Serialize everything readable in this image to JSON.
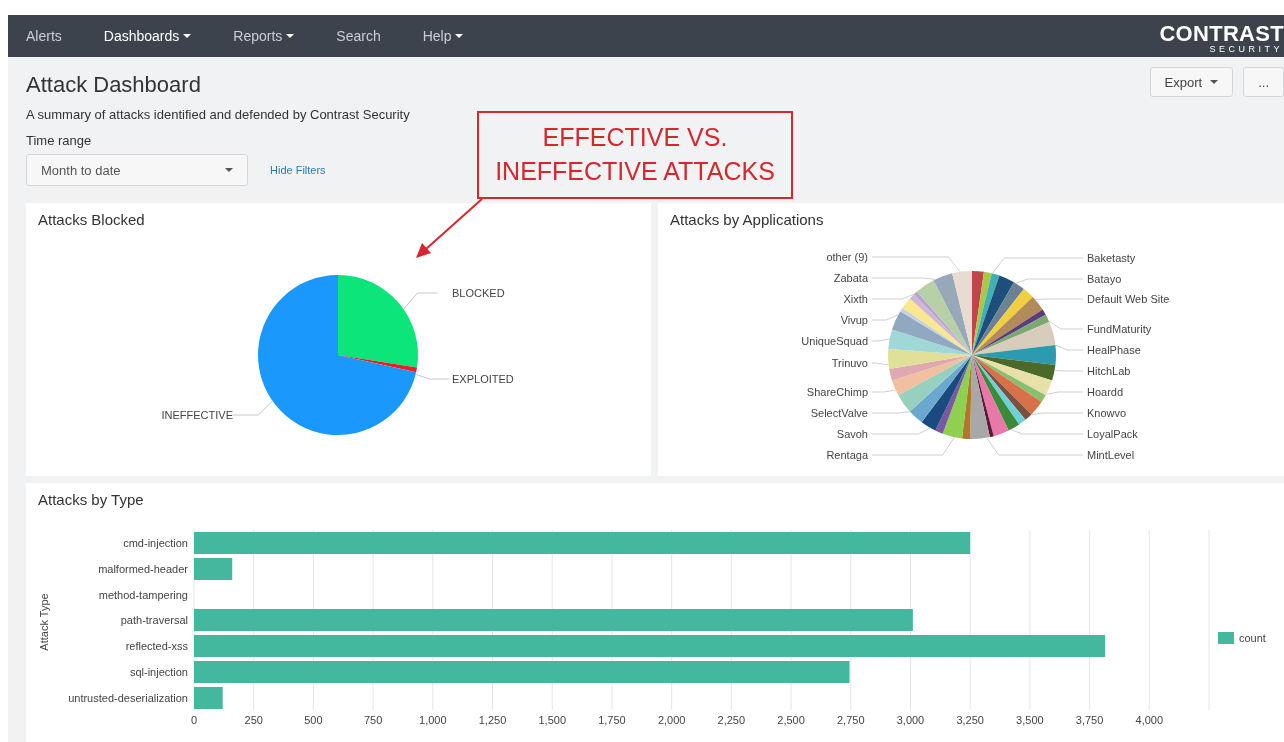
{
  "nav": {
    "items": [
      {
        "label": "Alerts",
        "caret": false,
        "selected": false
      },
      {
        "label": "Dashboards",
        "caret": true,
        "selected": true
      },
      {
        "label": "Reports",
        "caret": true,
        "selected": false
      },
      {
        "label": "Search",
        "caret": false,
        "selected": false
      },
      {
        "label": "Help",
        "caret": true,
        "selected": false
      }
    ],
    "logo": {
      "name": "CONTRAST",
      "tagline": "SECURITY"
    }
  },
  "page": {
    "title": "Attack Dashboard",
    "subtitle": "A summary of attacks identified and defended by Contrast Security",
    "actions": [
      {
        "label": "Export",
        "caret": true
      },
      {
        "label": "...",
        "caret": false
      }
    ],
    "filter": {
      "label": "Time range",
      "value": "Month to date",
      "link": "Hide Filters"
    }
  },
  "annotation": {
    "text": "EFFECTIVE VS. INEFFECTIVE ATTACKS"
  },
  "panels": [
    {
      "kind": "pie",
      "title": "Attacks Blocked",
      "slices": [
        {
          "label": "BLOCKED",
          "color": "#0be57a"
        },
        {
          "label": "EXPLOITED",
          "color": "#ee1d24"
        },
        {
          "label": "INEFFECTIVE",
          "color": "#1a98fc"
        }
      ]
    },
    {
      "kind": "multipie",
      "title": "Attacks by Applications",
      "left_labels": [
        "other (9)",
        "Zabata",
        "Xixth",
        "Vivup",
        "UniqueSquad",
        "Trinuvo",
        "ShareChimp",
        "SelectValve",
        "Savoh",
        "Rentaga"
      ],
      "right_labels": [
        "Baketasty",
        "Batayo",
        "Default Web Site",
        "FundMaturity",
        "HealPhase",
        "HitchLab",
        "Hoardd",
        "Knowvo",
        "LoyalPack",
        "MintLevel"
      ]
    },
    {
      "kind": "bar",
      "title": "Attacks by Type",
      "chart_data": {
        "type": "bar",
        "orientation": "horizontal",
        "ylabel": "Attack Type",
        "categories": [
          "cmd-injection",
          "malformed-header",
          "method-tampering",
          "path-traversal",
          "reflected-xss",
          "sql-injection",
          "untrusted-deserialization"
        ],
        "grid": true,
        "series": [
          {
            "name": "count",
            "color": "#43b89f",
            "values": [
              3250,
              160,
              0,
              3010,
              3815,
              2745,
              120
            ]
          }
        ],
        "xlim": [
          0,
          4250
        ],
        "xticks": [
          {
            "value": 0,
            "label": "0"
          },
          {
            "value": 250,
            "label": "250"
          },
          {
            "value": 500,
            "label": "500"
          },
          {
            "value": 750,
            "label": "750"
          },
          {
            "value": 1000,
            "label": "1,000"
          },
          {
            "value": 1250,
            "label": "1,250"
          },
          {
            "value": 1500,
            "label": "1,500"
          },
          {
            "value": 1750,
            "label": "1,750"
          },
          {
            "value": 2000,
            "label": "2,000"
          },
          {
            "value": 2250,
            "label": "2,250"
          },
          {
            "value": 2500,
            "label": "2,500"
          },
          {
            "value": 2750,
            "label": "2,750"
          },
          {
            "value": 3000,
            "label": "3,000"
          },
          {
            "value": 3250,
            "label": "3,250"
          },
          {
            "value": 3500,
            "label": "3,500"
          },
          {
            "value": 3750,
            "label": "3,750"
          },
          {
            "value": 4000,
            "label": "4,000"
          }
        ]
      }
    }
  ]
}
